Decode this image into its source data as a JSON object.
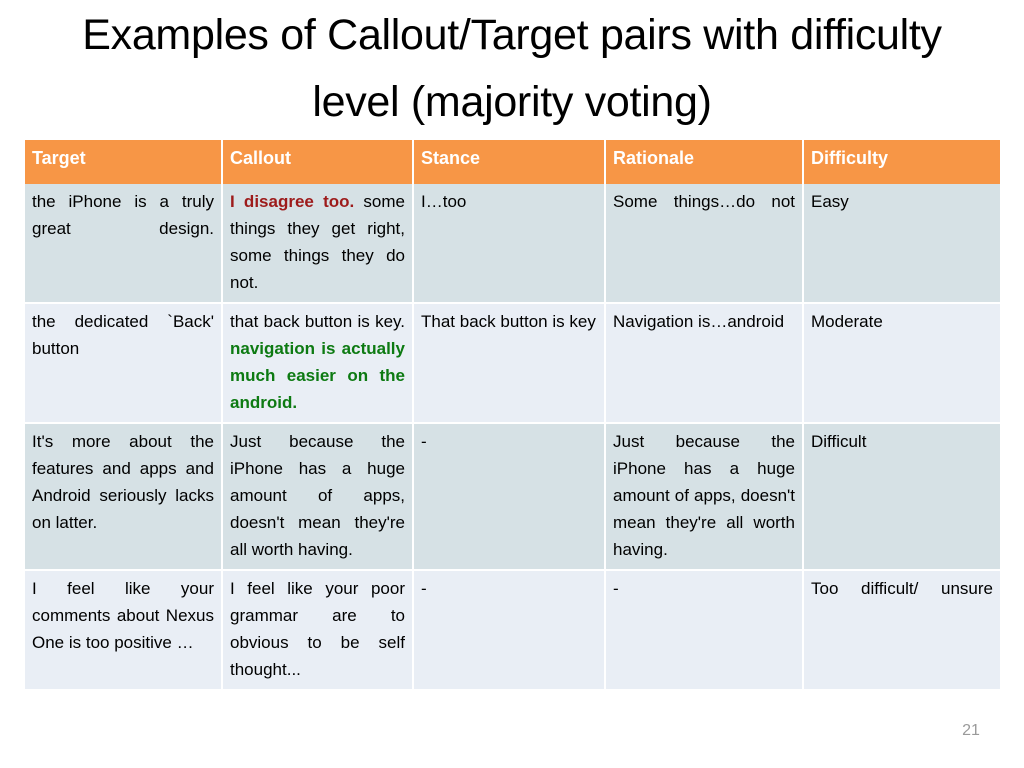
{
  "slide": {
    "title": "Examples of Callout/Target pairs with difficulty level (majority voting)",
    "page_number": "21",
    "colors": {
      "header_background": "#f79646",
      "header_text": "#ffffff",
      "row_dark": "#d6e1e5",
      "row_light": "#e9eef5",
      "emphasis_red": "#9d1b1b",
      "emphasis_green": "#0d7a12",
      "page_number_text": "#9a9a9a"
    }
  },
  "table": {
    "columns": [
      "Target",
      "Callout",
      "Stance",
      "Rationale",
      "Difficulty"
    ],
    "rows": [
      {
        "target": "the iPhone is a truly great design.",
        "callout_emphasis": "I disagree too.",
        "callout_rest": " some things they get right, some things they do not.",
        "callout_full": "I disagree too. some things they get right, some things they do not.",
        "stance": "I…too",
        "rationale": "Some things…do not",
        "difficulty": "Easy"
      },
      {
        "target": "the dedicated `Back' button",
        "callout_lead": "that back button is key. ",
        "callout_emphasis": "navigation is actually much easier on the android.",
        "callout_full": "that back button is key. navigation is actually much easier on the android.",
        "stance": "That back button is key",
        "rationale": "Navigation is…android",
        "difficulty": "Moderate"
      },
      {
        "target": "It's more about the features and apps and Android seriously lacks on latter.",
        "callout_full": "Just because the iPhone has a huge amount of apps, doesn't mean they're all worth having.",
        "stance": "-",
        "rationale": "Just because the iPhone has a huge amount of apps, doesn't mean they're all worth having.",
        "difficulty": "Difficult"
      },
      {
        "target": "I feel like your comments about Nexus One is too positive …",
        "callout_full": "I feel like your poor grammar are to obvious to be self thought...",
        "stance": "-",
        "rationale": "-",
        "difficulty": "Too difficult/ unsure"
      }
    ]
  }
}
